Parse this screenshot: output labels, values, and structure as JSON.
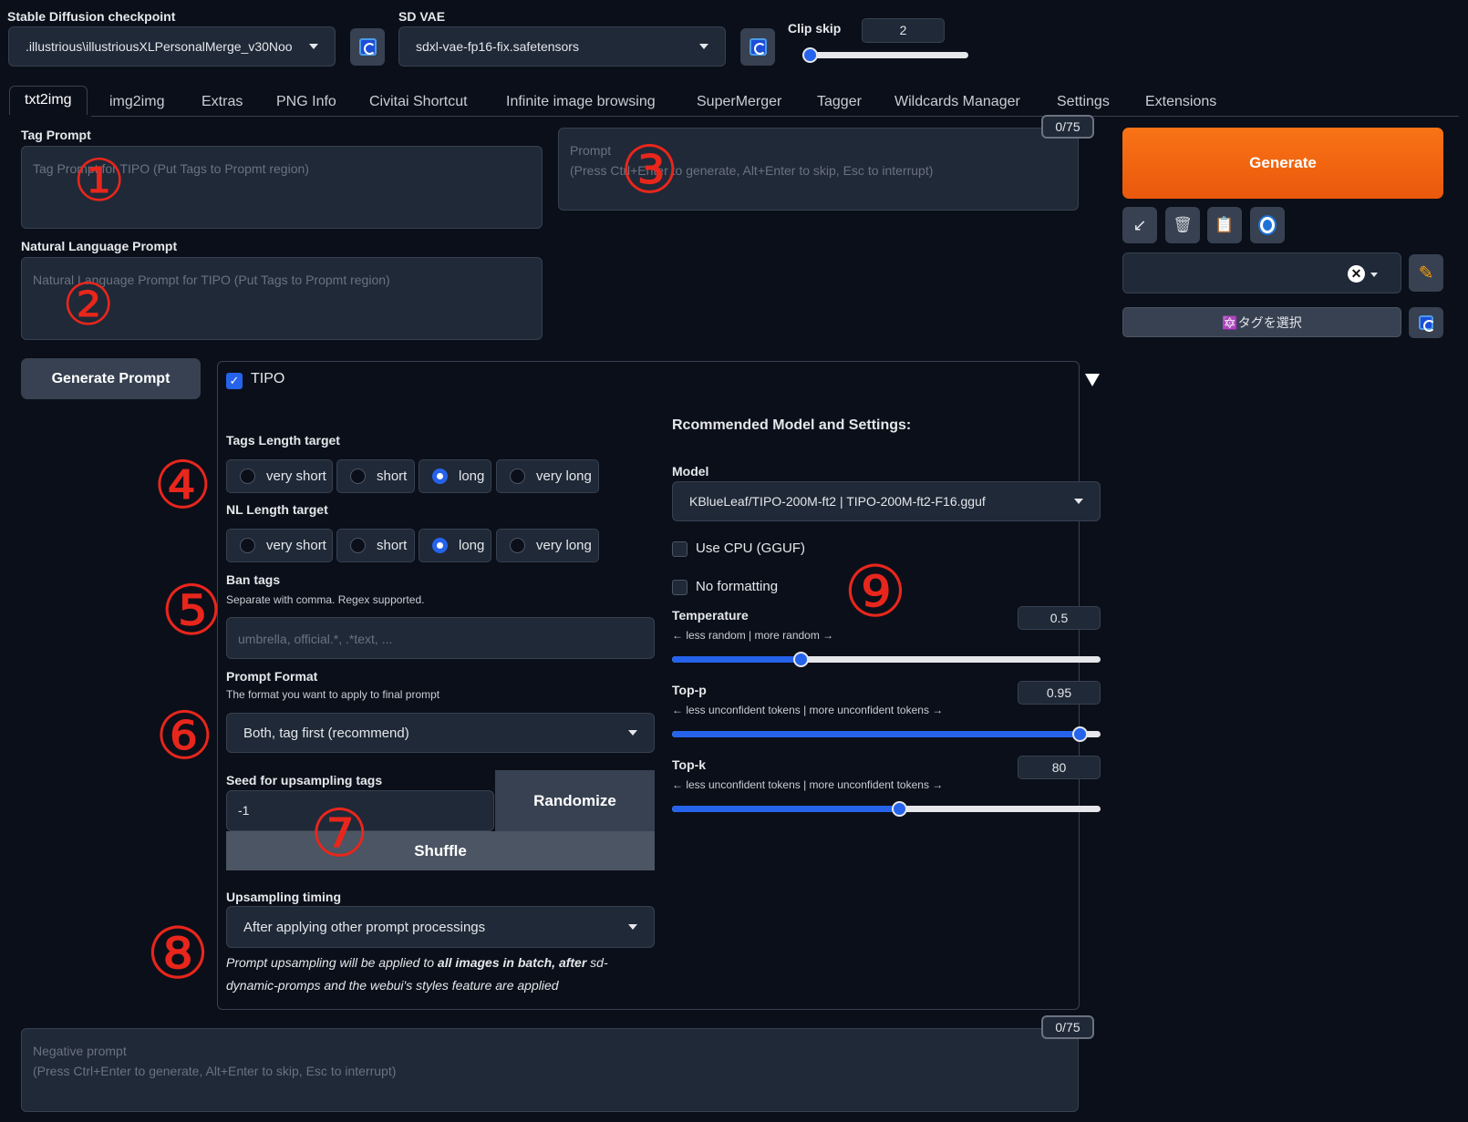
{
  "top": {
    "checkpoint_label": "Stable Diffusion checkpoint",
    "checkpoint_value": ".illustrious\\illustriousXLPersonalMerge_v30Noo",
    "vae_label": "SD VAE",
    "vae_value": "sdxl-vae-fp16-fix.safetensors",
    "clip_label": "Clip skip",
    "clip_value": "2",
    "clip_fraction": 0.0
  },
  "tabs": [
    "txt2img",
    "img2img",
    "Extras",
    "PNG Info",
    "Civitai Shortcut",
    "Infinite image browsing",
    "SuperMerger",
    "Tagger",
    "Wildcards Manager",
    "Settings",
    "Extensions"
  ],
  "prompts": {
    "tag_label": "Tag Prompt",
    "tag_placeholder": "Tag Prompt for TIPO (Put Tags to Propmt region)",
    "nl_label": "Natural Language Prompt",
    "nl_placeholder": "Natural Language Prompt for TIPO (Put Tags to Propmt region)",
    "main_placeholder_1": "Prompt",
    "main_placeholder_2": "(Press Ctrl+Enter to generate, Alt+Enter to skip, Esc to interrupt)",
    "counter": "0/75",
    "generate_prompt": "Generate Prompt",
    "negative_placeholder_1": "Negative prompt",
    "negative_placeholder_2": "(Press Ctrl+Enter to generate, Alt+Enter to skip, Esc to interrupt)",
    "negative_counter": "0/75"
  },
  "right": {
    "generate": "Generate",
    "tag_select": "🔯タグを選択",
    "colors": {
      "generate_start": "#f97316",
      "generate_end": "#ea580c"
    }
  },
  "tipo": {
    "title": "TIPO",
    "tags_length_label": "Tags Length target",
    "nl_length_label": "NL Length target",
    "length_options": [
      "very short",
      "short",
      "long",
      "very long"
    ],
    "tags_selected": "long",
    "nl_selected": "long",
    "ban_label": "Ban tags",
    "ban_sub": "Separate with comma. Regex supported.",
    "ban_placeholder": "umbrella, official.*, .*text, ...",
    "format_label": "Prompt Format",
    "format_sub": "The format you want to apply to final prompt",
    "format_value": "Both, tag first (recommend)",
    "seed_label": "Seed for upsampling tags",
    "seed_value": "-1",
    "randomize": "Randomize",
    "shuffle": "Shuffle",
    "timing_label": "Upsampling timing",
    "timing_value": "After applying other prompt processings",
    "note_1": "Prompt upsampling will be applied to ",
    "note_bold": "all images in batch, after",
    "note_2": " sd-",
    "note_3": "dynamic-promps and the webui's styles feature are applied",
    "recommend_title": "Rcommended Model and Settings:",
    "model_label": "Model",
    "model_value": "KBlueLeaf/TIPO-200M-ft2 | TIPO-200M-ft2-F16.gguf",
    "use_cpu": "Use CPU (GGUF)",
    "no_format": "No formatting",
    "temp_label": "Temperature",
    "temp_sub": "← less random | more random →",
    "temp_value": "0.5",
    "temp_fraction": 0.3,
    "topp_label": "Top-p",
    "topp_sub": "← less unconfident tokens | more unconfident tokens →",
    "topp_value": "0.95",
    "topp_fraction": 0.95,
    "topk_label": "Top-k",
    "topk_sub": "← less unconfident tokens | more unconfident tokens →",
    "topk_value": "80",
    "topk_fraction": 0.53
  },
  "annotations": [
    "①",
    "②",
    "③",
    "④",
    "⑤",
    "⑥",
    "⑦",
    "⑧",
    "⑨"
  ]
}
